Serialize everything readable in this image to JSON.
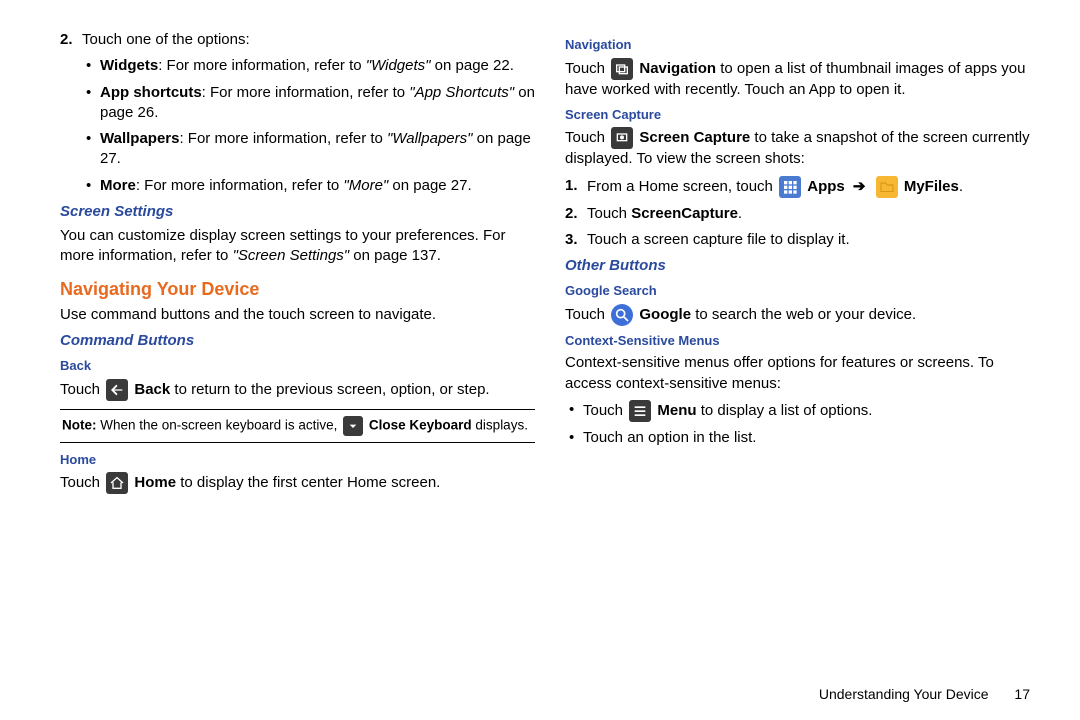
{
  "left": {
    "step2_intro": "Touch one of the options:",
    "step2_num": "2",
    "options": [
      {
        "label": "Widgets",
        "text": ": For more information, refer to ",
        "ref": "\"Widgets\"",
        "tail": "  on page 22."
      },
      {
        "label": "App shortcuts",
        "text": ": For more information, refer to ",
        "ref": "\"App Shortcuts\"",
        "tail": " on page 26."
      },
      {
        "label": "Wallpapers",
        "text": ": For more information, refer to ",
        "ref": "\"Wallpapers\"",
        "tail": "  on page 27."
      },
      {
        "label": "More",
        "text": ": For more information, refer to ",
        "ref": "\"More\"",
        "tail": "  on page 27."
      }
    ],
    "screen_settings": {
      "title": "Screen Settings",
      "body1": "You can customize display screen settings to your preferences. For more information, refer to ",
      "body_ref": "\"Screen Settings\"",
      "body_tail": "  on page 137."
    },
    "nav_title": "Navigating Your Device",
    "nav_body": "Use command buttons and the touch screen to navigate.",
    "cmd_title": "Command Buttons",
    "back_title": "Back",
    "back_body_pre": "Touch ",
    "back_label": "Back",
    "back_body_post": " to return to the previous screen, option, or step.",
    "note_pre": "Note: ",
    "note_mid": "When the on-screen keyboard is active, ",
    "note_label": "Close Keyboard",
    "note_tail": " displays.",
    "home_title": "Home",
    "home_pre": "Touch ",
    "home_label": "Home",
    "home_post": " to display the first center Home screen."
  },
  "right": {
    "nav_title": "Navigation",
    "nav_pre": "Touch ",
    "nav_label": "Navigation",
    "nav_post": " to open a list of thumbnail images of apps you have worked with recently. Touch an App to open it.",
    "sc_title": "Screen Capture",
    "sc_pre": "Touch ",
    "sc_label": "Screen Capture",
    "sc_post": " to take a snapshot of the screen currently displayed. To view the screen shots:",
    "sc_s1_num": "1",
    "sc_s1_pre": "From a Home screen, touch ",
    "sc_s1_apps": "Apps",
    "sc_s1_arrow": "➔",
    "sc_s1_my": "MyFiles",
    "sc_s1_tail": ".",
    "sc_s2_num": "2",
    "sc_s2_pre": "Touch ",
    "sc_s2_label": "ScreenCapture",
    "sc_s2_tail": ".",
    "sc_s3_num": "3",
    "sc_s3": "Touch a screen capture file to display it.",
    "other_title": "Other Buttons",
    "google_title": "Google Search",
    "google_pre": "Touch ",
    "google_label": "Google",
    "google_post": " to search the web or your device.",
    "ctx_title": "Context-Sensitive Menus",
    "ctx_body": "Context-sensitive menus offer options for features or screens. To access context-sensitive menus:",
    "ctx_b1_pre": "Touch ",
    "ctx_b1_label": "Menu",
    "ctx_b1_post": " to display a list of options.",
    "ctx_b2": "Touch an option in the list."
  },
  "footer": {
    "section": "Understanding Your Device",
    "page": "17"
  }
}
